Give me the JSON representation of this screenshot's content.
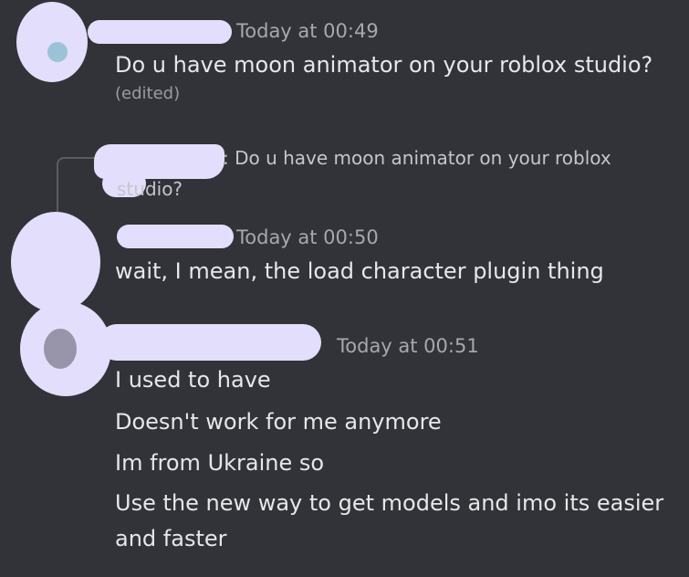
{
  "messages": [
    {
      "timestamp": "Today at 00:49",
      "lines": [
        "Do u have moon animator on your roblox studio?"
      ],
      "edited": "(edited)"
    },
    {
      "reply_preview": ": Do u have moon animator on your roblox",
      "reply_preview_cont": "studio?",
      "timestamp": "Today at 00:50",
      "lines": [
        "wait, I mean, the load character plugin thing"
      ]
    },
    {
      "timestamp": "Today at 00:51",
      "lines": [
        "I used to have",
        "Doesn't work for me anymore",
        "Im from Ukraine so",
        "Use the new way to get models and imo its easier",
        "and faster"
      ]
    }
  ],
  "colors": {
    "background": "#313338",
    "redaction": "#e2defb",
    "timestamp": "#a6a8ad",
    "message_text": "#e6e7e9"
  }
}
